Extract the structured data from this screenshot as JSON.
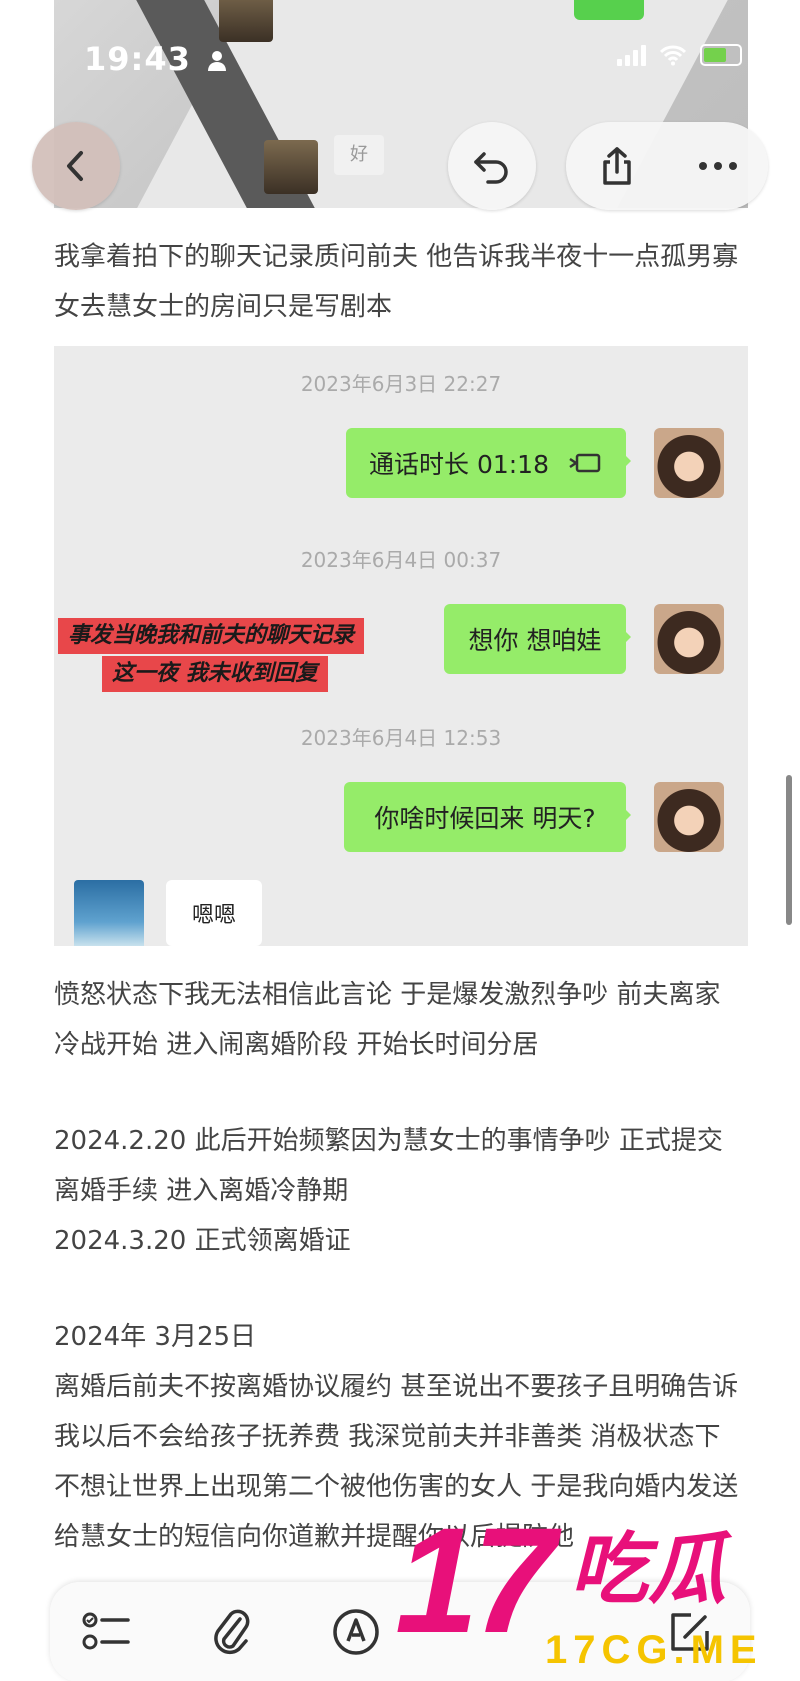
{
  "status_bar": {
    "time": "19:43",
    "person_icon": "person-icon",
    "signal_icon": "signal-icon",
    "wifi_icon": "wifi-icon",
    "battery_icon": "battery-charging-icon"
  },
  "background_photo": {
    "chip_text": "好"
  },
  "nav": {
    "back_icon": "chevron-left-icon",
    "undo_icon": "undo-icon",
    "share_icon": "share-icon",
    "more_icon": "more-horizontal-icon"
  },
  "paragraphs": {
    "p1": "我拿着拍下的聊天记录质问前夫 他告诉我半夜十一点孤男寡女去慧女士的房间只是写剧本",
    "p2": "愤怒状态下我无法相信此言论 于是爆发激烈争吵 前夫离家 冷战开始 进入闹离婚阶段 开始长时间分居",
    "p3_line1": "2024.2.20 此后开始频繁因为慧女士的事情争吵 正式提交离婚手续 进入离婚冷静期",
    "p3_line2": "2024.3.20  正式领离婚证",
    "p4_date": "2024年 3月25日",
    "p4_body": "离婚后前夫不按离婚协议履约  甚至说出不要孩子且明确告诉我以后不会给孩子抚养费 我深觉前夫并非善类 消极状态下不想让世界上出现第二个被他伤害的女人 于是我向婚内发送给慧女士的短信向你道歉并提醒你以后提防他"
  },
  "chat": {
    "timestamp1": "2023年6月3日 22:27",
    "call_bubble": "通话时长 01:18",
    "call_icon": "phone-handset-icon",
    "timestamp2": "2023年6月4日 00:37",
    "bubble2": "想你 想咱娃",
    "annotation_line1": "事发当晚我和前夫的聊天记录",
    "annotation_line2": "这一夜 我未收到回复",
    "timestamp3": "2023年6月4日 12:53",
    "bubble3": "你啥时候回来 明天?",
    "reply": "嗯嗯"
  },
  "toolbar": {
    "checklist_icon": "checklist-icon",
    "attachment_icon": "paperclip-icon",
    "markup_icon": "pen-markup-icon",
    "compose_icon": "compose-icon"
  },
  "watermark": {
    "number": "17",
    "chinese": "吃瓜",
    "domain": "17CG.ME"
  },
  "colors": {
    "chat_sent": "#95ec69",
    "annotation_red": "#e8474a",
    "watermark_pink": "#e8107a",
    "watermark_yellow": "#f5c400"
  }
}
